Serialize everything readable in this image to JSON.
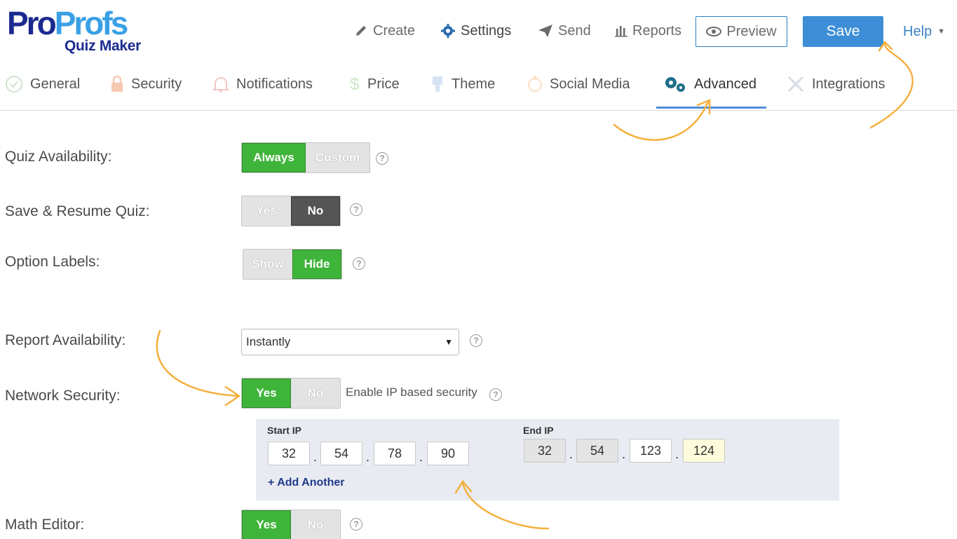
{
  "logo": {
    "main_a": "Pro",
    "main_b": "Profs",
    "sub": "Quiz Maker"
  },
  "topnav": {
    "create": "Create",
    "settings": "Settings",
    "send": "Send",
    "reports": "Reports",
    "preview": "Preview",
    "save": "Save",
    "help": "Help"
  },
  "tabs": [
    {
      "label": "General",
      "icon": "check-circle-icon"
    },
    {
      "label": "Security",
      "icon": "lock-icon"
    },
    {
      "label": "Notifications",
      "icon": "bell-icon"
    },
    {
      "label": "Price",
      "icon": "dollar-icon"
    },
    {
      "label": "Theme",
      "icon": "brush-icon"
    },
    {
      "label": "Social Media",
      "icon": "share-icon"
    },
    {
      "label": "Advanced",
      "icon": "gears-icon",
      "active": true
    },
    {
      "label": "Integrations",
      "icon": "tools-icon"
    }
  ],
  "form": {
    "quiz_availability": {
      "label": "Quiz Availability:",
      "options": [
        "Always",
        "Custom"
      ],
      "selected": "Always"
    },
    "save_resume": {
      "label": "Save & Resume Quiz:",
      "options": [
        "Yes",
        "No"
      ],
      "selected": "No"
    },
    "option_labels": {
      "label": "Option Labels:",
      "options": [
        "Show",
        "Hide"
      ],
      "selected": "Hide"
    },
    "report_availability": {
      "label": "Report Availability:",
      "value": "Instantly"
    },
    "network_security": {
      "label": "Network Security:",
      "options": [
        "Yes",
        "No"
      ],
      "selected": "Yes",
      "hint": "Enable IP based security"
    },
    "math_editor": {
      "label": "Math Editor:",
      "options": [
        "Yes",
        "No"
      ],
      "selected": "Yes"
    }
  },
  "ip": {
    "start_label": "Start IP",
    "start": [
      "32",
      "54",
      "78",
      "90"
    ],
    "end_label": "End IP",
    "end": [
      "32",
      "54",
      "123",
      "124"
    ],
    "add_another": "+ Add Another"
  },
  "help_mark": "?",
  "colors": {
    "green": "#3fb43a",
    "blue": "#3d8ed6",
    "dark": "#555555",
    "annotation": "#f4b03e"
  }
}
